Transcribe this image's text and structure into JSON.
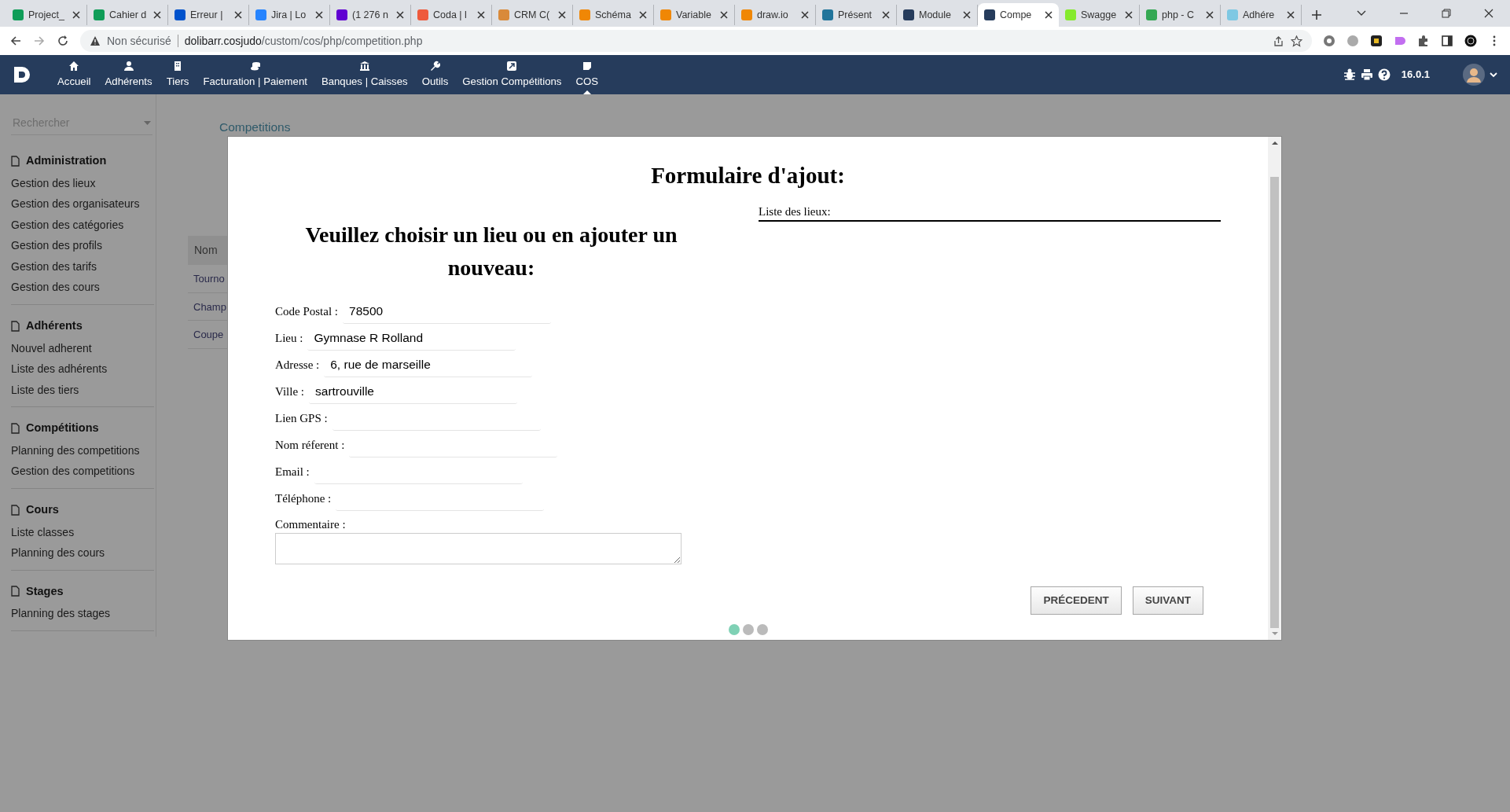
{
  "browser": {
    "tabs": [
      {
        "title": "Project_",
        "color": "#0f9d58",
        "selected": false
      },
      {
        "title": "Cahier d",
        "color": "#0f9d58",
        "selected": false
      },
      {
        "title": "Erreur |",
        "color": "#0052cc",
        "selected": false
      },
      {
        "title": "Jira | Lo",
        "color": "#2684ff",
        "selected": false
      },
      {
        "title": "(1 276 n",
        "color": "#6001d2",
        "selected": false
      },
      {
        "title": "Coda | l",
        "color": "#ee5a3c",
        "selected": false
      },
      {
        "title": "CRM C(",
        "color": "#d98a3a",
        "selected": false
      },
      {
        "title": "Schéma",
        "color": "#f08705",
        "selected": false
      },
      {
        "title": "Variable",
        "color": "#f08705",
        "selected": false
      },
      {
        "title": "draw.io",
        "color": "#f08705",
        "selected": false
      },
      {
        "title": "Présent",
        "color": "#21759b",
        "selected": false
      },
      {
        "title": "Module",
        "color": "#263c5c",
        "selected": false
      },
      {
        "title": "Compe",
        "color": "#263c5c",
        "selected": true
      },
      {
        "title": "Swagge",
        "color": "#85ea2d",
        "selected": false
      },
      {
        "title": "php - C",
        "color": "#34a853",
        "selected": false
      },
      {
        "title": "Adhére",
        "color": "#7ec8e3",
        "selected": false
      }
    ],
    "security": "Non sécurisé",
    "url_host": "dolibarr.cosjudo",
    "url_path": "/custom/cos/php/competition.php"
  },
  "topnav": {
    "items": [
      {
        "label": "Accueil",
        "selected": false
      },
      {
        "label": "Adhérents",
        "selected": false
      },
      {
        "label": "Tiers",
        "selected": false
      },
      {
        "label": "Facturation | Paiement",
        "selected": false
      },
      {
        "label": "Banques | Caisses",
        "selected": false
      },
      {
        "label": "Outils",
        "selected": false
      },
      {
        "label": "Gestion Compétitions",
        "selected": false
      },
      {
        "label": "COS",
        "selected": true
      }
    ],
    "version": "16.0.1"
  },
  "sidebar": {
    "search_placeholder": "Rechercher",
    "sections": [
      {
        "title": "Administration",
        "items": [
          "Gestion des lieux",
          "Gestion des organisateurs",
          "Gestion des catégories",
          "Gestion des profils",
          "Gestion des tarifs",
          "Gestion des cours"
        ]
      },
      {
        "title": "Adhérents",
        "items": [
          "Nouvel adherent",
          "Liste des adhérents",
          "Liste des tiers"
        ]
      },
      {
        "title": "Compétitions",
        "items": [
          "Planning des competitions",
          "Gestion des competitions"
        ]
      },
      {
        "title": "Cours",
        "items": [
          "Liste classes",
          "Planning des cours"
        ]
      },
      {
        "title": "Stages",
        "items": [
          "Planning des stages"
        ]
      }
    ]
  },
  "breadcrumb": "Competitions",
  "table": {
    "column_header": "Nom",
    "rows": [
      "Tourno",
      "Champ",
      "Coupe"
    ]
  },
  "modal": {
    "title": "Formulaire d'ajout:",
    "heading": "Veuillez choisir un lieu ou en ajouter un nouveau:",
    "fields": [
      {
        "label": "Code Postal :",
        "value": "78500"
      },
      {
        "label": "Lieu :",
        "value": "Gymnase R Rolland"
      },
      {
        "label": "Adresse :",
        "value": "6, rue de marseille"
      },
      {
        "label": "Ville :",
        "value": "sartrouville"
      },
      {
        "label": "Lien GPS :"
      },
      {
        "label": "Nom réferent :"
      },
      {
        "label": "Email :"
      },
      {
        "label": "Téléphone :"
      }
    ],
    "comment_label": "Commentaire :",
    "list_label": "Liste des lieux:",
    "buttons": [
      "PRÉCEDENT",
      "SUIVANT"
    ],
    "steps": [
      {
        "selected": true
      },
      {
        "selected": false
      },
      {
        "selected": false
      }
    ]
  }
}
